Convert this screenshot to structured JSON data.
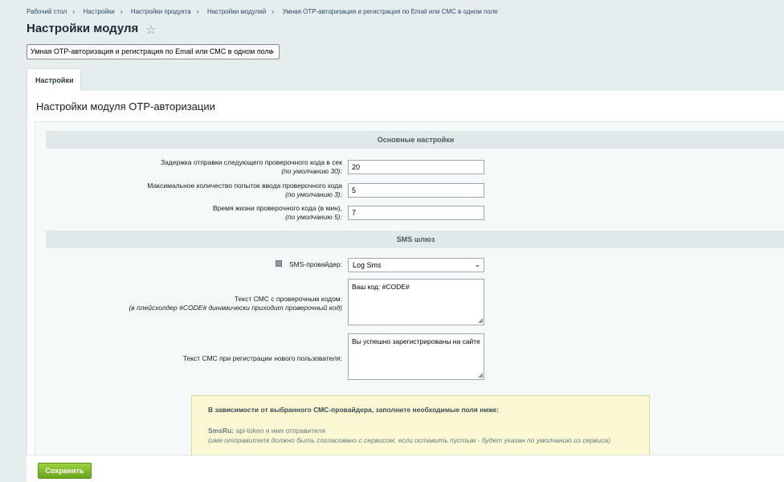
{
  "breadcrumb": [
    "Рабочий стол",
    "Настройки",
    "Настройки продукта",
    "Настройки модулей",
    "Умная OTP-авторизация и регистрация по Email или СМС в одном поле"
  ],
  "breadcrumb_separator": "›",
  "page_title": "Настройки модуля",
  "module_select": {
    "value": "Умная OTP-авторизация и регистрация по Email или СМС в одном поле",
    "icon": "chevron-down-icon"
  },
  "tab": {
    "label": "Настройки"
  },
  "panel_title": "Настройки модуля OTP-авторизации",
  "sections": {
    "main": "Основные настройки",
    "sms": "SMS шлюз"
  },
  "fields": {
    "delay": {
      "label": "Задержка отправки следующего проверочного кода в сек",
      "hint": "(по умолчанию 30):",
      "value": "20"
    },
    "attempts": {
      "label": "Максимальное количество попыток ввода проверочного кода",
      "hint": "(по умолчанию 3):",
      "value": "5"
    },
    "lifetime": {
      "label": "Время жизни проверочного кода (в мин),",
      "hint": "(по умолчанию 5):",
      "value": "7"
    },
    "provider": {
      "label": "SMS-провайдер:",
      "value": "Log Sms"
    },
    "sms_text": {
      "label": "Текст СМС с проверочным кодом:",
      "hint": "(в плейсхолдер #CODE# динамически приходит проверочный код)",
      "value": "Ваш код: #CODE#"
    },
    "reg_text": {
      "label": "Текст СМС при регистрации нового пользователя:",
      "value": "Вы успешно зарегистрированы на сайте"
    }
  },
  "notice": {
    "heading": "В зависимости от выбранного СМС-провайдера, заполните необходимые поля ниже:",
    "provider_name": "SmsRu:",
    "provider_fields": " api-token и имя отправителя",
    "provider_note": "(имя отправителя должно быть согласовано с сервисом, если оставить пустым - будет указан по умолчанию из сервиса)"
  },
  "save_label": "Сохранить",
  "colors": {
    "save_button": "#7ab72a",
    "section_header": "#e0e8ea",
    "notice_bg": "#fbf9d4"
  }
}
